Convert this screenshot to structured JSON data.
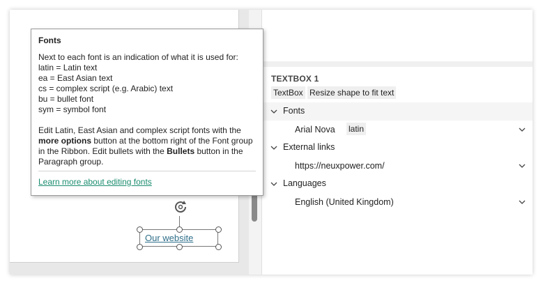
{
  "tooltip": {
    "title": "Fonts",
    "intro": "Next to each font is an indication of what it is used for:",
    "legend": [
      "latin = Latin text",
      "ea = East Asian text",
      "cs = complex script (e.g. Arabic) text",
      "bu = bullet font",
      "sym = symbol font"
    ],
    "p2_1": "Edit Latin, East Asian and complex script fonts with the",
    "p2_bold1": "more options",
    "p2_2": " button at the bottom right of the Font group",
    "p2_3": "in the Ribbon. Edit bullets with the ",
    "p2_bold2": "Bullets",
    "p2_4": " button in the",
    "p2_5": "Paragraph group.",
    "link": "Learn more about editing fonts"
  },
  "slide": {
    "shape_text": "Our website"
  },
  "panel": {
    "section_title": "TEXTBOX 1",
    "tags": [
      "TextBox",
      "Resize shape to fit text"
    ],
    "groups": [
      {
        "label": "Fonts",
        "value": "Arial Nova",
        "chip": "latin"
      },
      {
        "label": "External links",
        "value": "https://neuxpower.com/"
      },
      {
        "label": "Languages",
        "value": "English (United Kingdom)"
      }
    ]
  },
  "colors": {
    "highlight_border": "#e06c2c",
    "status_dot": "#f5c400",
    "link": "#1a8c6e"
  }
}
